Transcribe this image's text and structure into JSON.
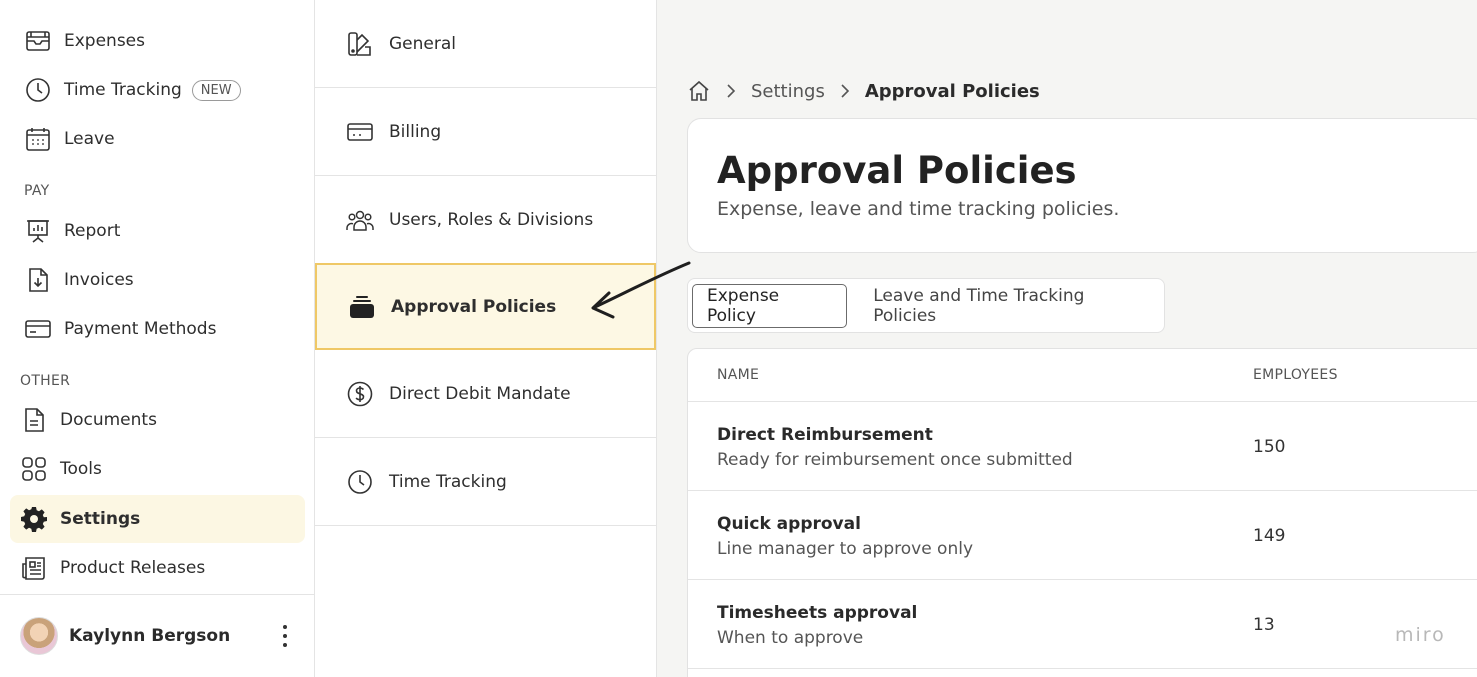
{
  "sidebar": {
    "items": [
      {
        "label": "Expenses",
        "icon": "wallet-icon"
      },
      {
        "label": "Time Tracking",
        "icon": "clock-icon",
        "badge": "NEW"
      },
      {
        "label": "Leave",
        "icon": "calendar-icon"
      },
      {
        "label": "Report",
        "icon": "report-icon"
      },
      {
        "label": "Invoices",
        "icon": "invoice-icon"
      },
      {
        "label": "Payment Methods",
        "icon": "credit-card-icon"
      },
      {
        "label": "Documents",
        "icon": "document-icon"
      },
      {
        "label": "Tools",
        "icon": "grid-icon"
      },
      {
        "label": "Settings",
        "icon": "gear-icon",
        "active": true
      },
      {
        "label": "Product Releases",
        "icon": "newspaper-icon"
      }
    ],
    "sections": {
      "pay": "PAY",
      "other": "OTHER"
    },
    "user": {
      "name": "Kaylynn Bergson"
    }
  },
  "settings_menu": {
    "items": [
      {
        "label": "General",
        "icon": "palette-icon"
      },
      {
        "label": "Billing",
        "icon": "card-icon"
      },
      {
        "label": "Users, Roles & Divisions",
        "icon": "users-icon"
      },
      {
        "label": "Approval Policies",
        "icon": "stack-icon",
        "active": true
      },
      {
        "label": "Direct Debit Mandate",
        "icon": "dollar-icon"
      },
      {
        "label": "Time Tracking",
        "icon": "clock-icon"
      }
    ]
  },
  "breadcrumb": {
    "home": "home-icon",
    "parent": "Settings",
    "current": "Approval Policies"
  },
  "header": {
    "title": "Approval Policies",
    "subtitle": "Expense, leave and time tracking policies."
  },
  "tabs": [
    {
      "label": "Expense Policy",
      "active": true
    },
    {
      "label": "Leave and Time Tracking Policies",
      "active": false
    }
  ],
  "table": {
    "columns": [
      "NAME",
      "EMPLOYEES"
    ],
    "rows": [
      {
        "name": "Direct Reimbursement",
        "description": "Ready for reimbursement once submitted",
        "employees": "150"
      },
      {
        "name": "Quick approval",
        "description": "Line manager to approve only",
        "employees": "149"
      },
      {
        "name": "Timesheets approval",
        "description": "When to approve",
        "employees": "13"
      }
    ]
  },
  "watermark": "miro",
  "colors": {
    "active_bg": "#fcf7e3",
    "active_border": "#efc866"
  }
}
